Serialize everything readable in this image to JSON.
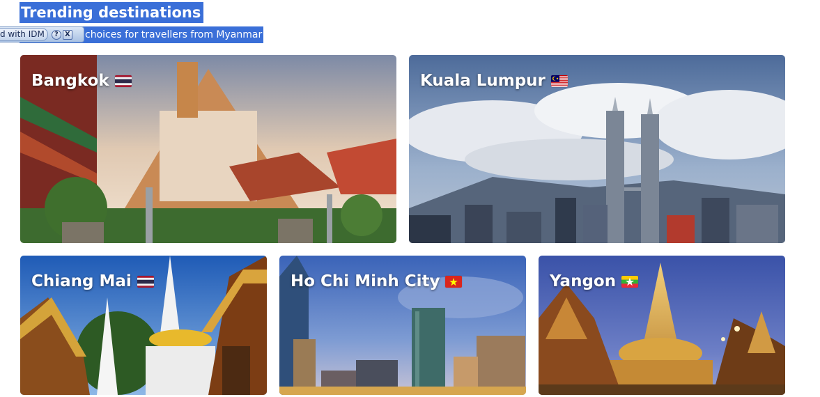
{
  "header": {
    "title": "Trending destinations",
    "subtitle": "Most popular choices for travellers from Myanmar",
    "subtitle_visible": "choices for travellers from Myanmar"
  },
  "idm_panel": {
    "label": "d with IDM",
    "help": "?",
    "close": "X"
  },
  "destinations": [
    {
      "name": "Bangkok",
      "country_flag": "thailand-flag"
    },
    {
      "name": "Kuala Lumpur",
      "country_flag": "malaysia-flag"
    },
    {
      "name": "Chiang Mai",
      "country_flag": "thailand-flag"
    },
    {
      "name": "Ho Chi Minh City",
      "country_flag": "vietnam-flag"
    },
    {
      "name": "Yangon",
      "country_flag": "myanmar-flag"
    }
  ],
  "colors": {
    "selection": "#3a6fd8",
    "card_text": "#ffffff"
  }
}
